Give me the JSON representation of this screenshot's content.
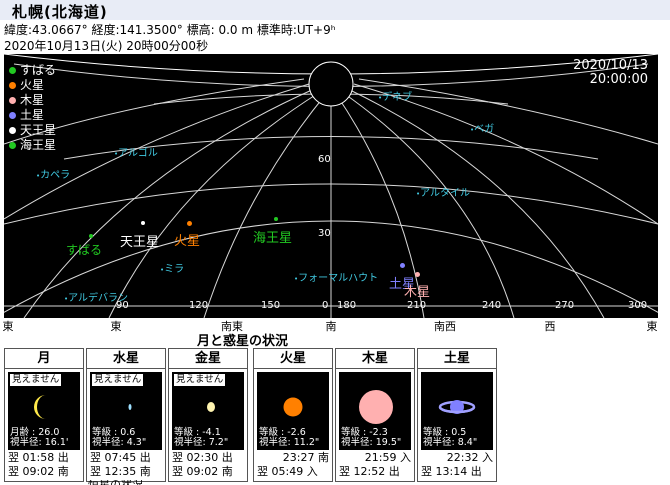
{
  "header": {
    "title": "札幌(北海道)",
    "info_line": "緯度:43.0667°  経度:141.3500°  標高: 0.0 m  標準時:UT+9ʰ",
    "datetime_line": "2020年10月13日(火) 20時00分00秒"
  },
  "sky": {
    "date": "2020/10/13",
    "time": "20:00:00",
    "legend": [
      {
        "label": "すばる",
        "color": "#22c822"
      },
      {
        "label": "火星",
        "color": "#ff8000"
      },
      {
        "label": "木星",
        "color": "#ffb0b0"
      },
      {
        "label": "土星",
        "color": "#8080ff"
      },
      {
        "label": "天王星",
        "color": "#ffffff"
      },
      {
        "label": "海王星",
        "color": "#22c822"
      }
    ],
    "altitude_labels": [
      "60",
      "30",
      "0"
    ],
    "azimuth_labels": [
      "90",
      "120",
      "150",
      "180",
      "210",
      "240",
      "270",
      "300"
    ],
    "stars": [
      {
        "name": "デネブ"
      },
      {
        "name": "ベガ"
      },
      {
        "name": "アルゴル"
      },
      {
        "name": "カペラ"
      },
      {
        "name": "アルタイル"
      },
      {
        "name": "ミラ"
      },
      {
        "name": "フォーマルハウト"
      },
      {
        "name": "アルデバラン"
      }
    ],
    "bodies": {
      "subaru": "すばる",
      "uranus": "天王星",
      "mars": "火星",
      "neptune": "海王星",
      "saturn": "土星",
      "jupiter": "木星"
    }
  },
  "directions": [
    "東",
    "東",
    "南東",
    "南",
    "南",
    "南西",
    "西",
    "東"
  ],
  "status_title": "月と惑星の状況",
  "planets": [
    {
      "name": "月",
      "visibility": "見えません",
      "line1": "月齢 : 26.0",
      "line2": "視半径: 16.1'",
      "rise": "翌 01:58 出",
      "set": "翌 09:02 南",
      "icon": "moon"
    },
    {
      "name": "水星",
      "visibility": "見えません",
      "line1": "等級 :  0.6",
      "line2": "視半径:  4.3\"",
      "rise": "翌 07:45 出",
      "set": "翌 12:35 南",
      "icon": "mercury"
    },
    {
      "name": "金星",
      "visibility": "見えません",
      "line1": "等級 : -4.1",
      "line2": "視半径:  7.2\"",
      "rise": "翌 02:30 出",
      "set": "翌 09:02 南",
      "icon": "venus"
    },
    {
      "name": "火星",
      "visibility": "",
      "line1": "等級 : -2.6",
      "line2": "視半径: 11.2\"",
      "rise": "23:27 南",
      "set": "翌 05:49 入",
      "icon": "mars"
    },
    {
      "name": "木星",
      "visibility": "",
      "line1": "等級 : -2.3",
      "line2": "視半径: 19.5\"",
      "rise": "21:59 入",
      "set": "翌 12:52 出",
      "icon": "jupiter"
    },
    {
      "name": "土星",
      "visibility": "",
      "line1": "等級 :  0.5",
      "line2": "視半径:  8.4\"",
      "rise": "22:32 入",
      "set": "翌 13:14 出",
      "icon": "saturn"
    }
  ],
  "truncated_footer": "恒星の状況"
}
